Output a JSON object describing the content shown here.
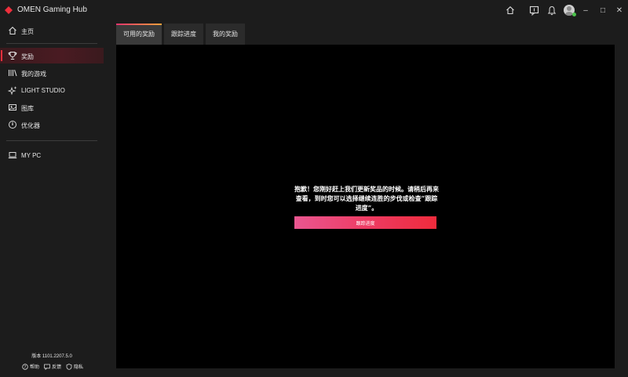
{
  "app": {
    "title": "OMEN Gaming Hub",
    "accent_color": "#ee2f3c",
    "logo_icon": "omen-diamond-logo"
  },
  "titlebar": {
    "icons": [
      "home-icon",
      "support-chat-icon",
      "bell-icon",
      "avatar",
      "minimize-icon",
      "maximize-icon",
      "close-icon"
    ],
    "minimize": "–",
    "maximize": "□",
    "close": "✕"
  },
  "sidebar": {
    "items": [
      {
        "label": "主页",
        "icon": "home-icon"
      },
      {
        "label": "奖励",
        "icon": "trophy-icon",
        "active": true
      },
      {
        "label": "我的游戏",
        "icon": "game-library-icon"
      },
      {
        "label": "LIGHT STUDIO",
        "icon": "sparkle-icon"
      },
      {
        "label": "图库",
        "icon": "gallery-icon"
      },
      {
        "label": "优化器",
        "icon": "optimizer-icon"
      },
      {
        "label": "MY PC",
        "icon": "laptop-icon"
      }
    ],
    "version": "版本 1101.2207.5.0",
    "footer": [
      {
        "label": "帮助",
        "icon": "help-icon"
      },
      {
        "label": "反馈",
        "icon": "feedback-icon"
      },
      {
        "label": "隐私",
        "icon": "privacy-icon"
      }
    ]
  },
  "tabs": [
    {
      "label": "可用的奖励",
      "active": true
    },
    {
      "label": "跟踪进度"
    },
    {
      "label": "我的奖励"
    }
  ],
  "main": {
    "message": "抱歉！您刚好赶上我们更新奖品的时候。请稍后再来查看，到时您可以选择继续连胜的步伐或检查“跟踪进度”。",
    "button_label": "跟踪进度"
  }
}
